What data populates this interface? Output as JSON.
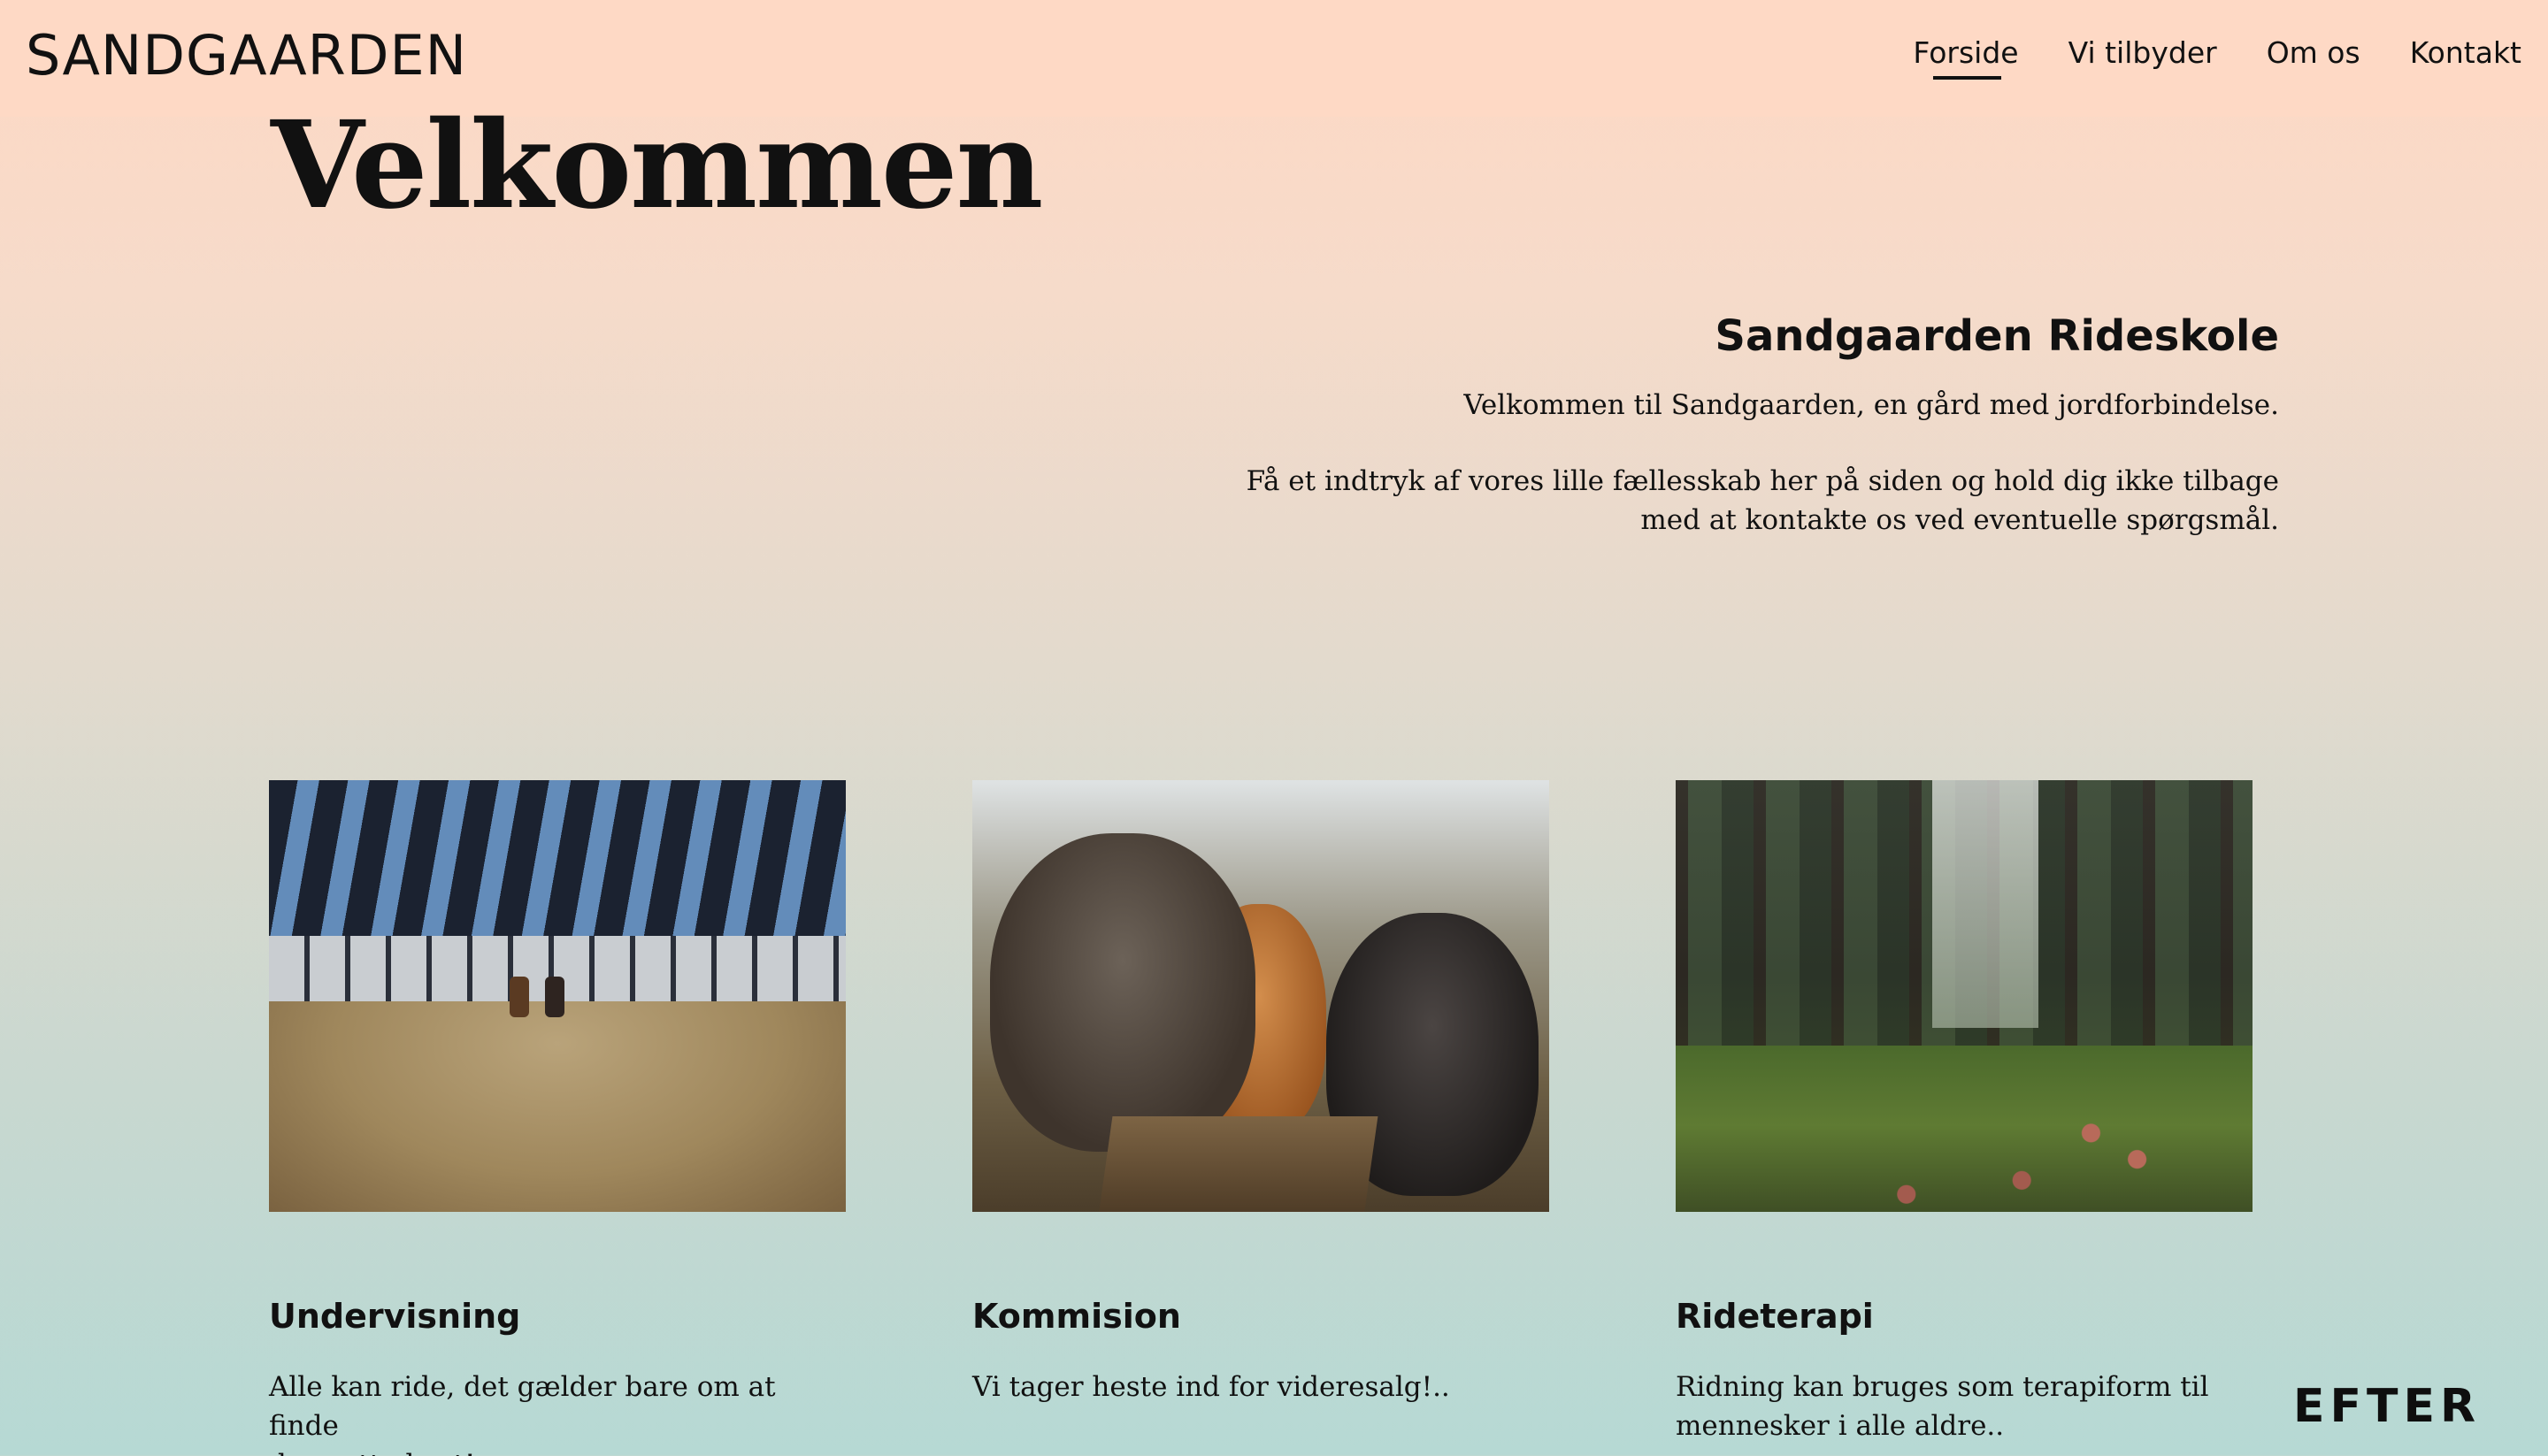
{
  "header": {
    "logo": "SANDGAARDEN",
    "nav": [
      {
        "label": "Forside",
        "active": true
      },
      {
        "label": "Vi tilbyder",
        "active": false
      },
      {
        "label": "Om os",
        "active": false
      },
      {
        "label": "Kontakt",
        "active": false
      }
    ]
  },
  "hero": {
    "title": "Velkommen"
  },
  "intro": {
    "heading": "Sandgaarden Rideskole",
    "paragraph1": "Velkommen til Sandgaarden, en gård med jordforbindelse.",
    "paragraph2_line1": "Få et indtryk af vores lille fællesskab her på siden og hold dig ikke tilbage",
    "paragraph2_line2": "med at kontakte os ved eventuelle spørgsmål."
  },
  "cards": [
    {
      "title": "Undervisning",
      "text_line1": "Alle kan ride, det gælder bare om at finde",
      "text_line2": "den rette hest!..",
      "image": "riding-hall-photo"
    },
    {
      "title": "Kommision",
      "text_line1": "Vi tager heste ind for videresalg!..",
      "text_line2": "",
      "image": "horses-photo"
    },
    {
      "title": "Rideterapi",
      "text_line1": "Ridning kan bruges som terapiform til",
      "text_line2": "mennesker i alle aldre..",
      "image": "forest-photo"
    }
  ],
  "badge": {
    "label": "EFTER"
  },
  "colors": {
    "header_bg": "#fed9c5",
    "gradient_top": "#fed8c4",
    "gradient_bottom": "#b6d9d4",
    "text": "#111111"
  }
}
